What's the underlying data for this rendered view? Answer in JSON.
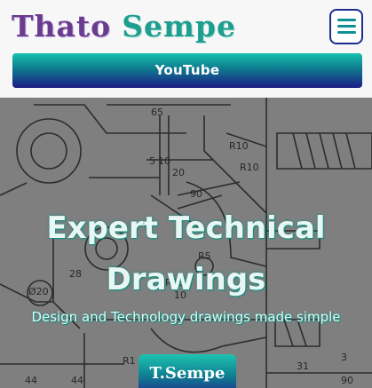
{
  "brand": {
    "first": "Thato",
    "last": "Sempe"
  },
  "menu": {
    "icon": "hamburger-menu-icon"
  },
  "youtube_button": {
    "label": "YouTube"
  },
  "hero": {
    "title_line1": "Expert Technical",
    "title_line2": "Drawings",
    "subtitle": "Design and Technology drawings made simple",
    "cta_label": "T.Sempe"
  },
  "drawing_labels": [
    "65",
    "R10",
    "R10",
    "5",
    "10",
    "20",
    "90",
    "R5",
    "R10",
    "Ø20",
    "28",
    "10",
    "R1",
    "44",
    "44",
    "31",
    "3",
    "90"
  ],
  "colors": {
    "accent_teal": "#1f9d8e",
    "accent_purple": "#6a3b8e",
    "accent_navy": "#1c2d8c"
  }
}
